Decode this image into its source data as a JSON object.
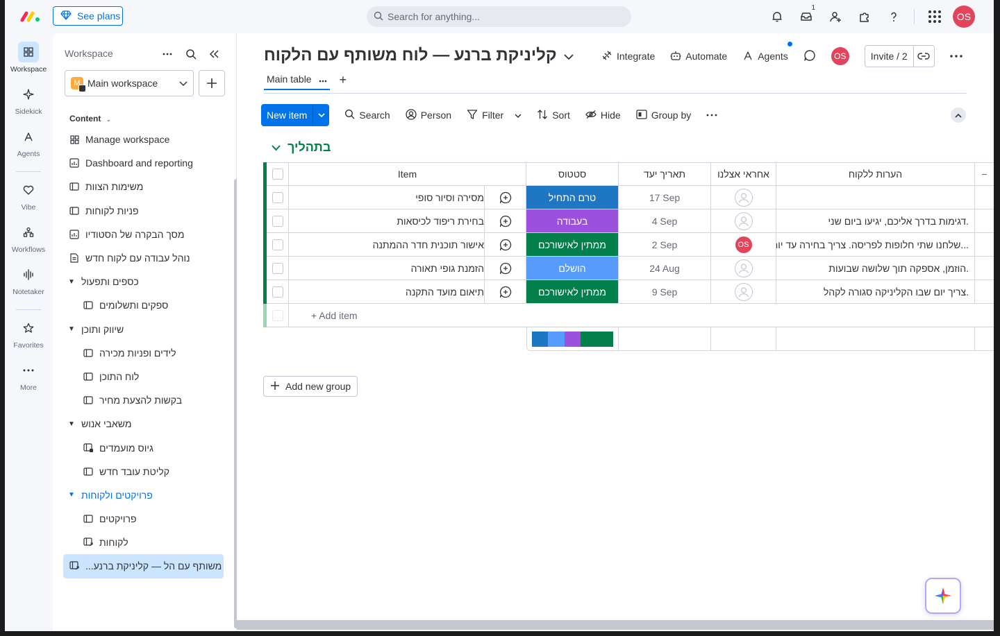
{
  "topbar": {
    "see_plans": "See plans",
    "search_placeholder": "Search for anything...",
    "inbox_count": "1",
    "avatar_initials": "OS"
  },
  "rail": {
    "workspace": "Workspace",
    "sidekick": "Sidekick",
    "agents": "Agents",
    "vibe": "Vibe",
    "workflows": "Workflows",
    "notetaker": "Notetaker",
    "favorites": "Favorites",
    "more": "More"
  },
  "panel": {
    "title": "Workspace",
    "workspace_name": "Main workspace",
    "workspace_badge": "M",
    "content_label": "Content",
    "items": [
      {
        "label": "Manage workspace",
        "icon": "grid-icon"
      },
      {
        "label": "Dashboard and reporting",
        "icon": "dashboard-icon"
      },
      {
        "label": "משימות הצוות",
        "icon": "board-icon"
      },
      {
        "label": "פניות לקוחות",
        "icon": "board-icon"
      },
      {
        "label": "מסך הבקרה של הסטודיו",
        "icon": "dashboard-icon"
      },
      {
        "label": "נוהל עבודה עם לקוח חדש",
        "icon": "doc-icon"
      },
      {
        "label": "כספים ותפעול",
        "icon": "folder"
      },
      {
        "label": "ספקים ותשלומים",
        "icon": "board-icon"
      },
      {
        "label": "שיווק ותוכן",
        "icon": "folder"
      },
      {
        "label": "לידים ופניות מכירה",
        "icon": "board-icon"
      },
      {
        "label": "לוח התוכן",
        "icon": "board-icon"
      },
      {
        "label": "בקשות להצעת מחיר",
        "icon": "board-icon"
      },
      {
        "label": "משאבי אנוש",
        "icon": "folder"
      },
      {
        "label": "גיוס מועמדים",
        "icon": "shared-board-icon"
      },
      {
        "label": "קליטת עובד חדש",
        "icon": "board-icon"
      },
      {
        "label": "פרויקטים ולקוחות",
        "icon": "folder"
      },
      {
        "label": "פרויקטים",
        "icon": "board-icon"
      },
      {
        "label": "לקוחות",
        "icon": "shared-board-icon"
      },
      {
        "label": "לוח משותף עם הל — קליניקת ברנע...",
        "icon": "shared-board-icon"
      }
    ]
  },
  "board": {
    "title": "קליניקת ברנע — לוח משותף עם הלקוח",
    "integrate": "Integrate",
    "automate": "Automate",
    "agents": "Agents",
    "avatar_initials": "OS",
    "invite": "Invite / 2",
    "tab_main": "Main table",
    "toolbar": {
      "new_item": "New item",
      "search": "Search",
      "person": "Person",
      "filter": "Filter",
      "sort": "Sort",
      "hide": "Hide",
      "group_by": "Group by"
    },
    "group_title": "בתהליך",
    "columns": {
      "item": "Item",
      "status": "סטטוס",
      "date": "תאריך יעד",
      "owner": "אחראי אצלנו",
      "notes": "הערות ללקוח",
      "more": "−"
    },
    "rows": [
      {
        "item": "מסירה וסיור סופי",
        "status": "טרם התחיל",
        "status_color": "#1f76c2",
        "date": "17 Sep",
        "owner": "",
        "notes": ""
      },
      {
        "item": "בחירת ריפוד לכיסאות",
        "status": "בעבודה",
        "status_color": "#9d50dd",
        "date": "4 Sep",
        "owner": "",
        "notes": "דגימות בדרך אליכם, יגיעו ביום שני."
      },
      {
        "item": "אישור תוכנית חדר ההמתנה",
        "status": "ממתין לאישורכם",
        "status_color": "#037f4c",
        "date": "2 Sep",
        "owner": "OS",
        "notes": "שלחנו שתי חלופות לפריסה. צריך בחירה עד יום..."
      },
      {
        "item": "הזמנת גופי תאורה",
        "status": "הושלם",
        "status_color": "#579bfc",
        "date": "24 Aug",
        "owner": "",
        "notes": "הוזמן, אספקה תוך שלושה שבועות."
      },
      {
        "item": "תיאום מועד התקנה",
        "status": "ממתין לאישורכם",
        "status_color": "#037f4c",
        "date": "9 Sep",
        "owner": "",
        "notes": "צריך יום שבו הקליניקה סגורה לקהל."
      }
    ],
    "add_item": "+ Add item",
    "summary": [
      {
        "color": "#1f76c2",
        "fraction": 0.2
      },
      {
        "color": "#579bfc",
        "fraction": 0.2
      },
      {
        "color": "#9d50dd",
        "fraction": 0.2
      },
      {
        "color": "#037f4c",
        "fraction": 0.4
      }
    ],
    "add_group": "Add new group"
  }
}
